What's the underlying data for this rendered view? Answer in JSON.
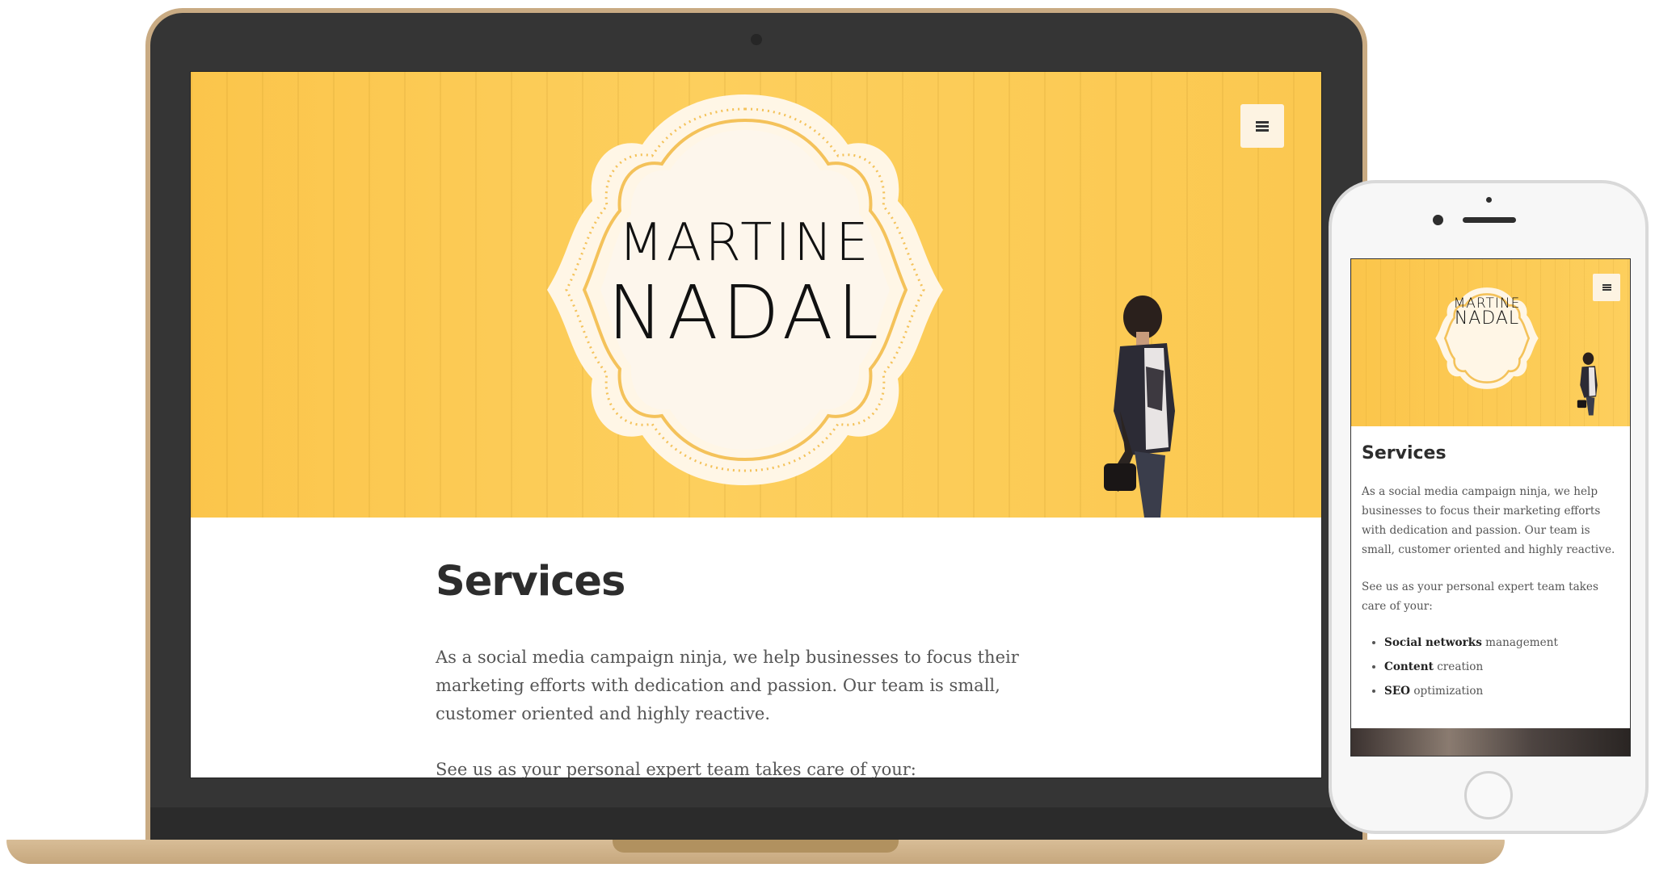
{
  "site": {
    "logo_line1": "MARTINE",
    "logo_line2": "NADAL",
    "menu_icon": "hamburger-menu-icon",
    "accent_color": "#fbc54b",
    "cream_color": "#fdf3e2"
  },
  "services": {
    "title": "Services",
    "intro": "As a social media campaign ninja, we help businesses to focus their marketing efforts with dedication and passion. Our team is small, customer oriented and highly reactive.",
    "lead": "See us as your personal expert team takes care of your:",
    "items": [
      {
        "bold": "Social networks",
        "rest": " management"
      },
      {
        "bold": "Content",
        "rest": " creation"
      },
      {
        "bold": "SEO",
        "rest": " optimization"
      }
    ]
  }
}
